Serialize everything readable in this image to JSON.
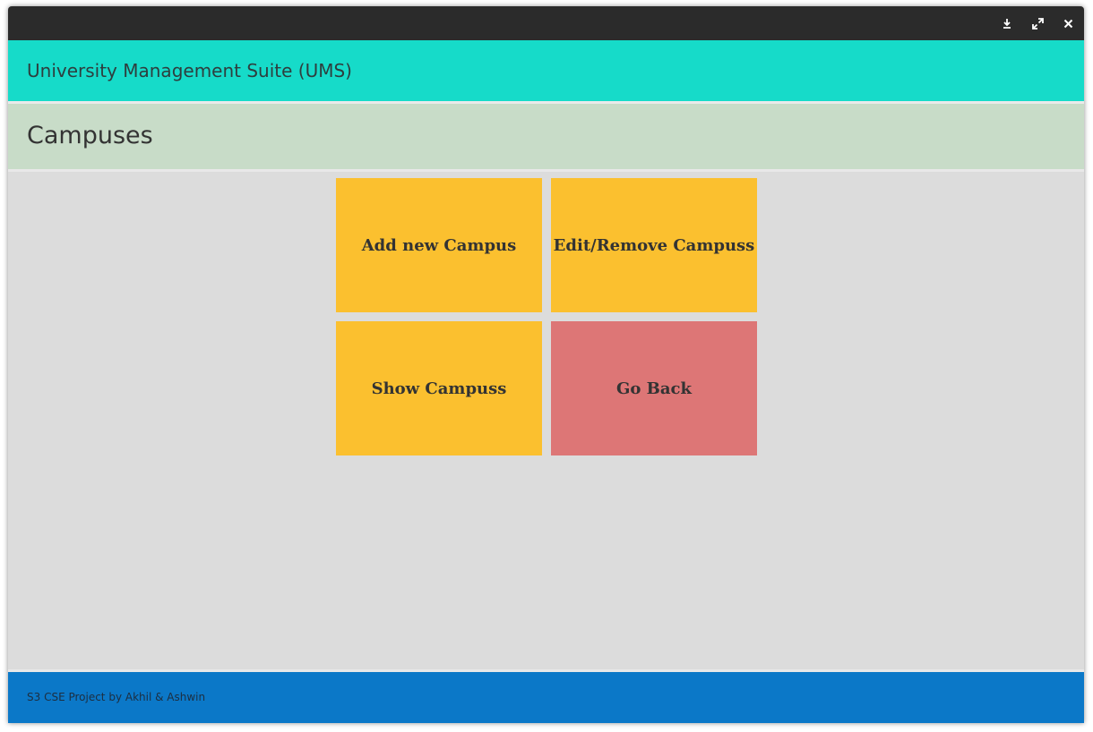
{
  "window": {
    "controls": [
      {
        "name": "download-icon",
        "label": "minimize"
      },
      {
        "name": "maximize-icon",
        "label": "maximize"
      },
      {
        "name": "close-icon",
        "label": "close"
      }
    ]
  },
  "header": {
    "title": "University Management Suite (UMS)"
  },
  "section": {
    "title": "Campuses"
  },
  "tiles": {
    "add": "Add new Campus",
    "edit": "Edit/Remove Campuss",
    "show": "Show Campuss",
    "back": "Go Back"
  },
  "footer": {
    "text": "S3 CSE Project by Akhil & Ashwin"
  },
  "colors": {
    "titlebar": "#2b2b2b",
    "header": "#16dbc9",
    "section": "#c8dcc8",
    "content": "#dcdcdc",
    "tile_primary": "#fbc02f",
    "tile_back": "#dd7676",
    "footer": "#0b78c8"
  }
}
